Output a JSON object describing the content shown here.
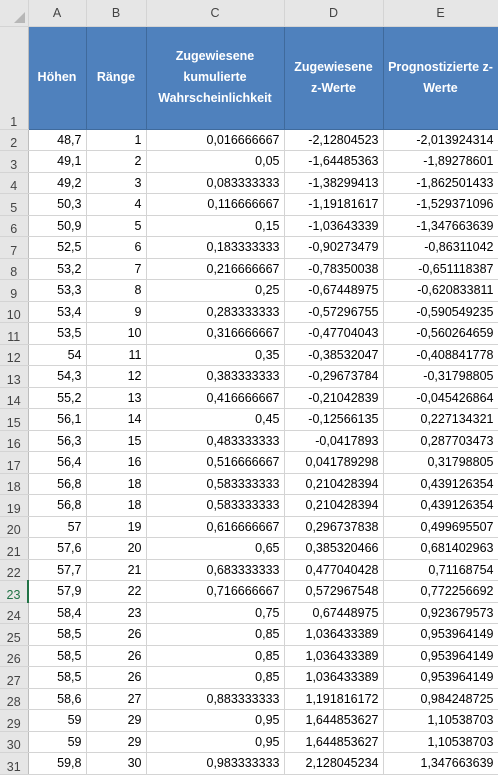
{
  "columns": [
    "A",
    "B",
    "C",
    "D",
    "E"
  ],
  "header_row_number": "1",
  "headers": [
    "Höhen",
    "Ränge",
    "Zugewiesene kumulierte Wahrscheinlichkeit",
    "Zugewiesene z-Werte",
    "Prognostizierte z-Werte"
  ],
  "active_row": "23",
  "header_fill_color": "#4f81bd",
  "rows": [
    {
      "n": "2",
      "a": "48,7",
      "b": "1",
      "c": "0,016666667",
      "d": "-2,12804523",
      "e": "-2,013924314"
    },
    {
      "n": "3",
      "a": "49,1",
      "b": "2",
      "c": "0,05",
      "d": "-1,64485363",
      "e": "-1,89278601"
    },
    {
      "n": "4",
      "a": "49,2",
      "b": "3",
      "c": "0,083333333",
      "d": "-1,38299413",
      "e": "-1,862501433"
    },
    {
      "n": "5",
      "a": "50,3",
      "b": "4",
      "c": "0,116666667",
      "d": "-1,19181617",
      "e": "-1,529371096"
    },
    {
      "n": "6",
      "a": "50,9",
      "b": "5",
      "c": "0,15",
      "d": "-1,03643339",
      "e": "-1,347663639"
    },
    {
      "n": "7",
      "a": "52,5",
      "b": "6",
      "c": "0,183333333",
      "d": "-0,90273479",
      "e": "-0,86311042"
    },
    {
      "n": "8",
      "a": "53,2",
      "b": "7",
      "c": "0,216666667",
      "d": "-0,78350038",
      "e": "-0,651118387"
    },
    {
      "n": "9",
      "a": "53,3",
      "b": "8",
      "c": "0,25",
      "d": "-0,67448975",
      "e": "-0,620833811"
    },
    {
      "n": "10",
      "a": "53,4",
      "b": "9",
      "c": "0,283333333",
      "d": "-0,57296755",
      "e": "-0,590549235"
    },
    {
      "n": "11",
      "a": "53,5",
      "b": "10",
      "c": "0,316666667",
      "d": "-0,47704043",
      "e": "-0,560264659"
    },
    {
      "n": "12",
      "a": "54",
      "b": "11",
      "c": "0,35",
      "d": "-0,38532047",
      "e": "-0,408841778"
    },
    {
      "n": "13",
      "a": "54,3",
      "b": "12",
      "c": "0,383333333",
      "d": "-0,29673784",
      "e": "-0,31798805"
    },
    {
      "n": "14",
      "a": "55,2",
      "b": "13",
      "c": "0,416666667",
      "d": "-0,21042839",
      "e": "-0,045426864"
    },
    {
      "n": "15",
      "a": "56,1",
      "b": "14",
      "c": "0,45",
      "d": "-0,12566135",
      "e": "0,227134321"
    },
    {
      "n": "16",
      "a": "56,3",
      "b": "15",
      "c": "0,483333333",
      "d": "-0,0417893",
      "e": "0,287703473"
    },
    {
      "n": "17",
      "a": "56,4",
      "b": "16",
      "c": "0,516666667",
      "d": "0,041789298",
      "e": "0,31798805"
    },
    {
      "n": "18",
      "a": "56,8",
      "b": "18",
      "c": "0,583333333",
      "d": "0,210428394",
      "e": "0,439126354"
    },
    {
      "n": "19",
      "a": "56,8",
      "b": "18",
      "c": "0,583333333",
      "d": "0,210428394",
      "e": "0,439126354"
    },
    {
      "n": "20",
      "a": "57",
      "b": "19",
      "c": "0,616666667",
      "d": "0,296737838",
      "e": "0,499695507"
    },
    {
      "n": "21",
      "a": "57,6",
      "b": "20",
      "c": "0,65",
      "d": "0,385320466",
      "e": "0,681402963"
    },
    {
      "n": "22",
      "a": "57,7",
      "b": "21",
      "c": "0,683333333",
      "d": "0,477040428",
      "e": "0,71168754"
    },
    {
      "n": "23",
      "a": "57,9",
      "b": "22",
      "c": "0,716666667",
      "d": "0,572967548",
      "e": "0,772256692"
    },
    {
      "n": "24",
      "a": "58,4",
      "b": "23",
      "c": "0,75",
      "d": "0,67448975",
      "e": "0,923679573"
    },
    {
      "n": "25",
      "a": "58,5",
      "b": "26",
      "c": "0,85",
      "d": "1,036433389",
      "e": "0,953964149"
    },
    {
      "n": "26",
      "a": "58,5",
      "b": "26",
      "c": "0,85",
      "d": "1,036433389",
      "e": "0,953964149"
    },
    {
      "n": "27",
      "a": "58,5",
      "b": "26",
      "c": "0,85",
      "d": "1,036433389",
      "e": "0,953964149"
    },
    {
      "n": "28",
      "a": "58,6",
      "b": "27",
      "c": "0,883333333",
      "d": "1,191816172",
      "e": "0,984248725"
    },
    {
      "n": "29",
      "a": "59",
      "b": "29",
      "c": "0,95",
      "d": "1,644853627",
      "e": "1,10538703"
    },
    {
      "n": "30",
      "a": "59",
      "b": "29",
      "c": "0,95",
      "d": "1,644853627",
      "e": "1,10538703"
    },
    {
      "n": "31",
      "a": "59,8",
      "b": "30",
      "c": "0,983333333",
      "d": "2,128045234",
      "e": "1,347663639"
    }
  ]
}
